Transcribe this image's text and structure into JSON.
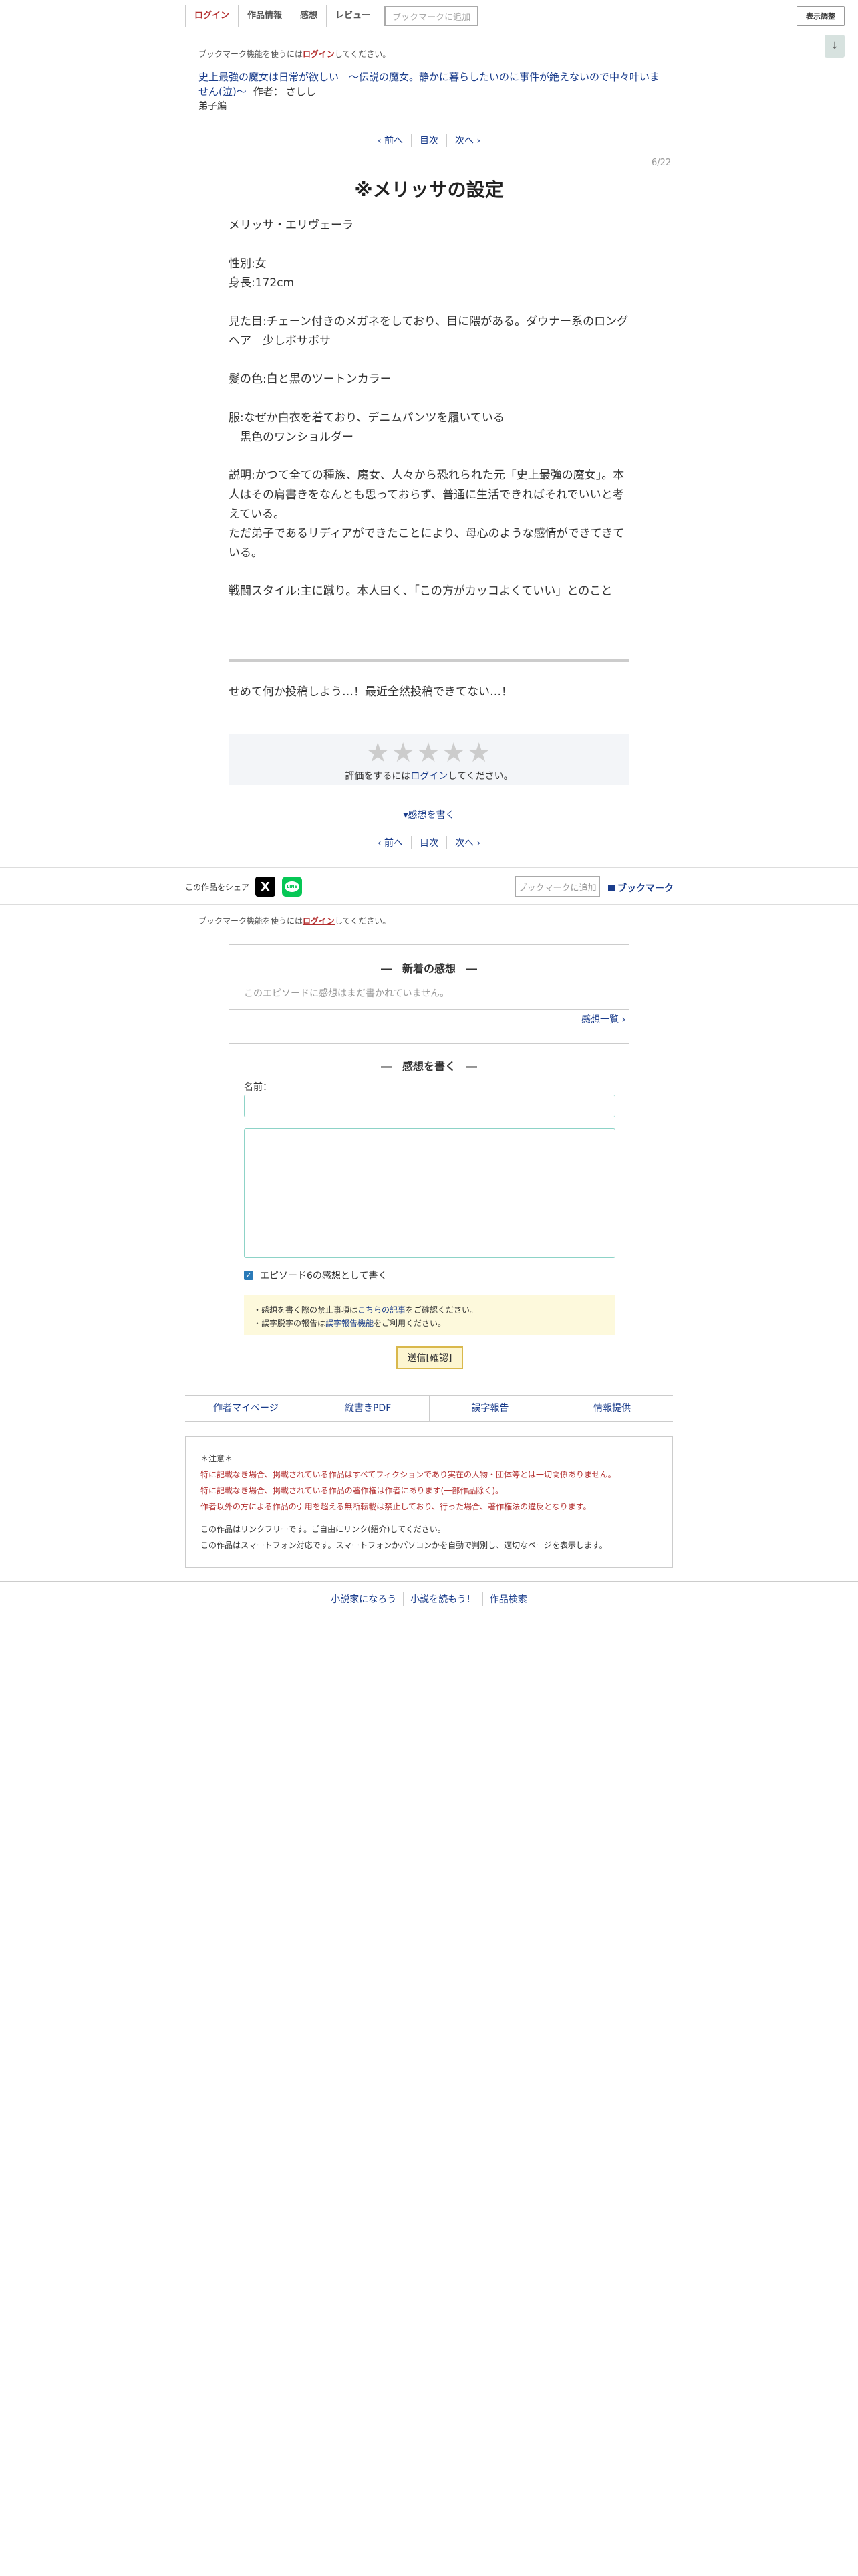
{
  "header": {
    "nav": [
      "ログイン",
      "作品情報",
      "感想",
      "レビュー"
    ],
    "bookmark_add": "ブックマークに追加",
    "display_settings": "表示調整",
    "scroll_arrow": "↓"
  },
  "bookmark_notice": {
    "prefix": "ブックマーク機能を使うには",
    "link": "ログイン",
    "suffix": "してください。"
  },
  "novel": {
    "title": "史上最強の魔女は日常が欲しい　〜伝説の魔女。静かに暮らしたいのに事件が絶えないので中々叶いません(泣)〜",
    "author_label": "作者：",
    "author": "さしし",
    "chapter": "弟子編"
  },
  "pager": {
    "prev": "‹ 前へ",
    "toc": "目次",
    "next": "次へ ›"
  },
  "episode": {
    "count": "6/22",
    "title": "※メリッサの設定",
    "lines": [
      "メリッサ・エリヴェーラ",
      "",
      "性別:女",
      "身長:172cm",
      "",
      "見た目:チェーン付きのメガネをしており、目に隈がある。ダウナー系のロングヘア　少しボサボサ",
      "",
      "髪の色:白と黒のツートンカラー",
      "",
      "服:なぜか白衣を着ており、デニムパンツを履いている",
      "　黒色のワンショルダー",
      "",
      "説明:かつて全ての種族、魔女、人々から恐れられた元「史上最強の魔女」。本人はその肩書きをなんとも思っておらず、普通に生活できればそれでいいと考えている。",
      "ただ弟子であるリディアができたことにより、母心のような感情ができてきている。",
      "",
      "戦闘スタイル:主に蹴り。本人曰く、「この方がカッコよくていい」とのこと"
    ],
    "afterword": "せめて何か投稿しよう…！最近全然投稿できてない…！"
  },
  "rating": {
    "stars": "★★★★★",
    "prefix": "評価をするには",
    "link": "ログイン",
    "suffix": "してください。"
  },
  "write_impression_link": "▾感想を書く",
  "share": {
    "label": "この作品をシェア",
    "x": "X",
    "line": "LINE",
    "bookmark_add": "ブックマークに追加",
    "bookmark_link": "ブックマーク"
  },
  "impressions": {
    "title": "―　新着の感想　―",
    "empty": "このエピソードに感想はまだ書かれていません。",
    "list_link": "感想一覧 ›"
  },
  "write_form": {
    "title": "―　感想を書く　―",
    "name_label": "名前：",
    "name_value": "",
    "body_value": "",
    "checkbox_label": "エピソード6の感想として書く",
    "notice1_prefix": "・感想を書く際の禁止事項は",
    "notice1_link": "こちらの記事",
    "notice1_suffix": "をご確認ください。",
    "notice2_prefix": "・誤字脱字の報告は",
    "notice2_link": "誤字報告機能",
    "notice2_suffix": "をご利用ください。",
    "submit": "送信[確認]"
  },
  "footer_links": [
    "作者マイページ",
    "縦書きPDF",
    "誤字報告",
    "情報提供"
  ],
  "notes": {
    "head": "＊注意＊",
    "red1": "特に記載なき場合、掲載されている作品はすべてフィクションであり実在の人物・団体等とは一切関係ありません。",
    "red2": "特に記載なき場合、掲載されている作品の著作権は作者にあります(一部作品除く)。",
    "red3": "作者以外の方による作品の引用を超える無断転載は禁止しており、行った場合、著作権法の違反となります。",
    "gray1": "この作品はリンクフリーです。ご自由にリンク(紹介)してください。",
    "gray2": "この作品はスマートフォン対応です。スマートフォンかパソコンかを自動で判別し、適切なページを表示します。"
  },
  "bottom_links": [
    "小説家になろう",
    "小説を読もう！",
    "作品検索"
  ]
}
